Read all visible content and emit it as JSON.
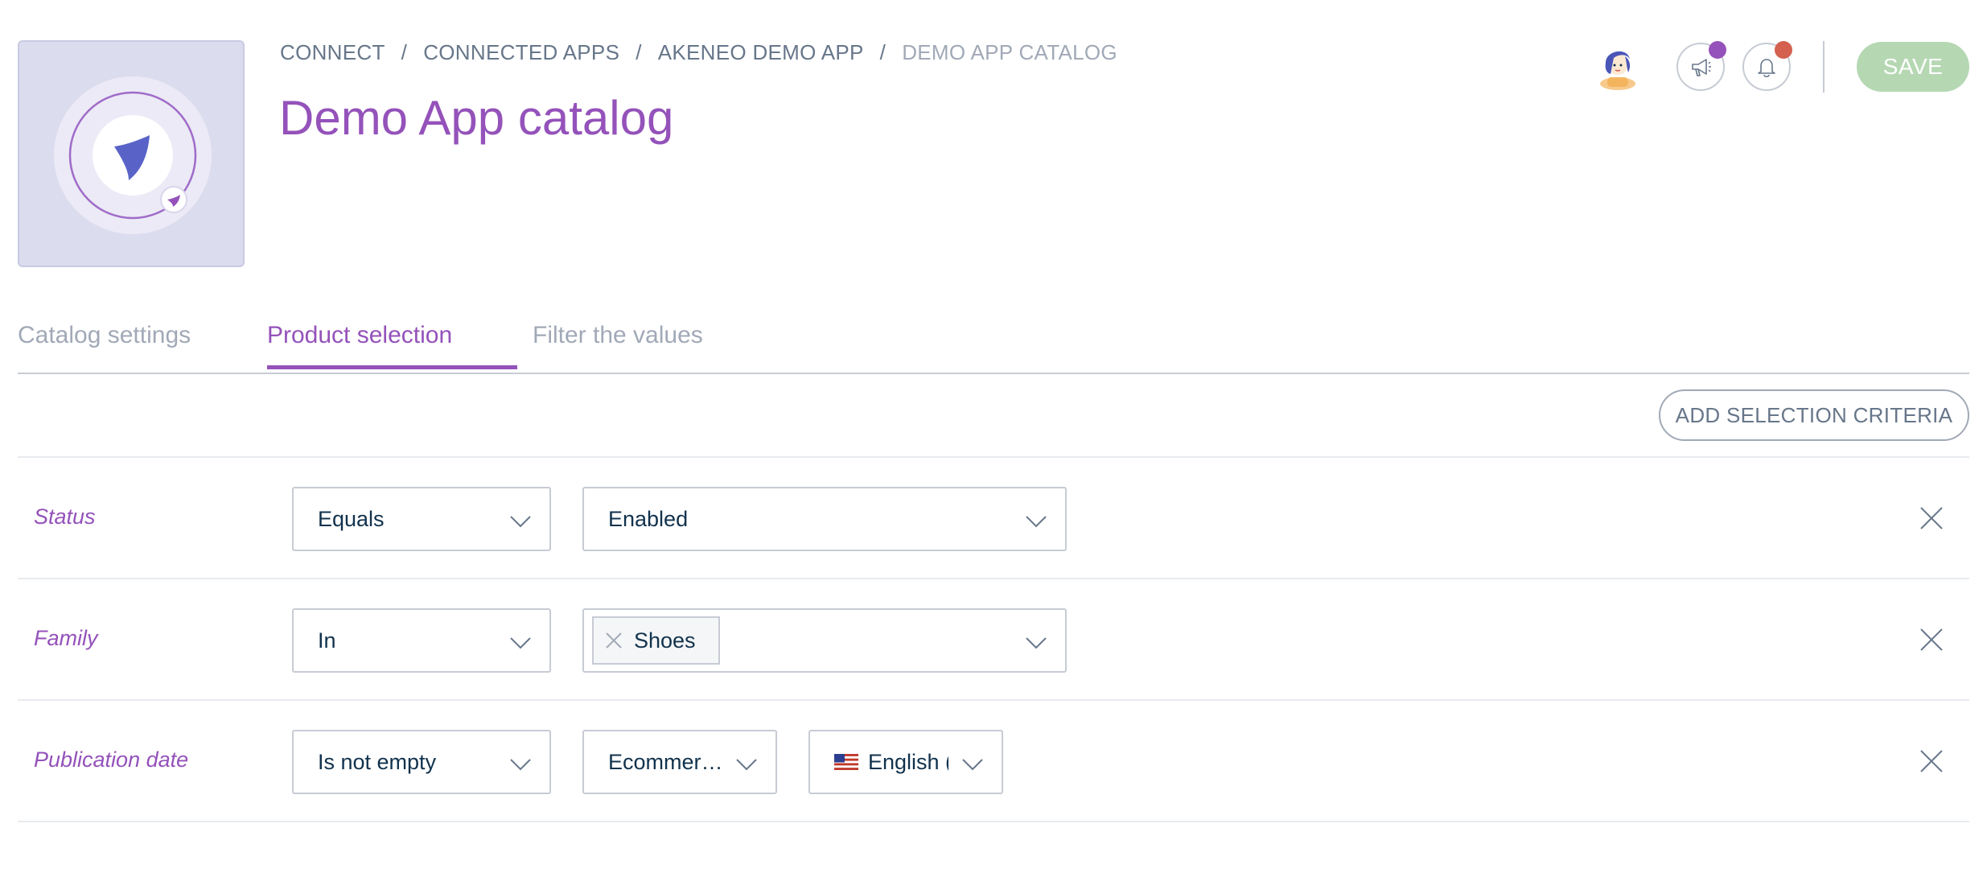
{
  "breadcrumb": [
    {
      "label": "CONNECT"
    },
    {
      "label": "CONNECTED APPS"
    },
    {
      "label": "AKENEO DEMO APP"
    },
    {
      "label": "DEMO APP CATALOG"
    }
  ],
  "breadcrumb_separator": "/",
  "page_title": "Demo App catalog",
  "header": {
    "save_label": "SAVE",
    "announcements_dot_color": "#9452ba",
    "notifications_dot_color": "#d4604f",
    "icons": [
      "avatar",
      "megaphone-icon",
      "bell-icon"
    ]
  },
  "tabs": [
    {
      "label": "Catalog settings",
      "active": false
    },
    {
      "label": "Product selection",
      "active": true
    },
    {
      "label": "Filter the values",
      "active": false
    }
  ],
  "toolbar": {
    "add_criteria_label": "ADD SELECTION CRITERIA"
  },
  "criteria": [
    {
      "field": "Status",
      "operator": "Equals",
      "value": "Enabled"
    },
    {
      "field": "Family",
      "operator": "In",
      "value_chip": "Shoes"
    },
    {
      "field": "Publication date",
      "operator": "Is not empty",
      "channel": "Ecommer…",
      "locale": "English ("
    }
  ],
  "colors": {
    "accent": "#9452ba",
    "text": "#11324d",
    "muted": "#a1a9b7",
    "save_disabled": "#b5d8b3"
  }
}
